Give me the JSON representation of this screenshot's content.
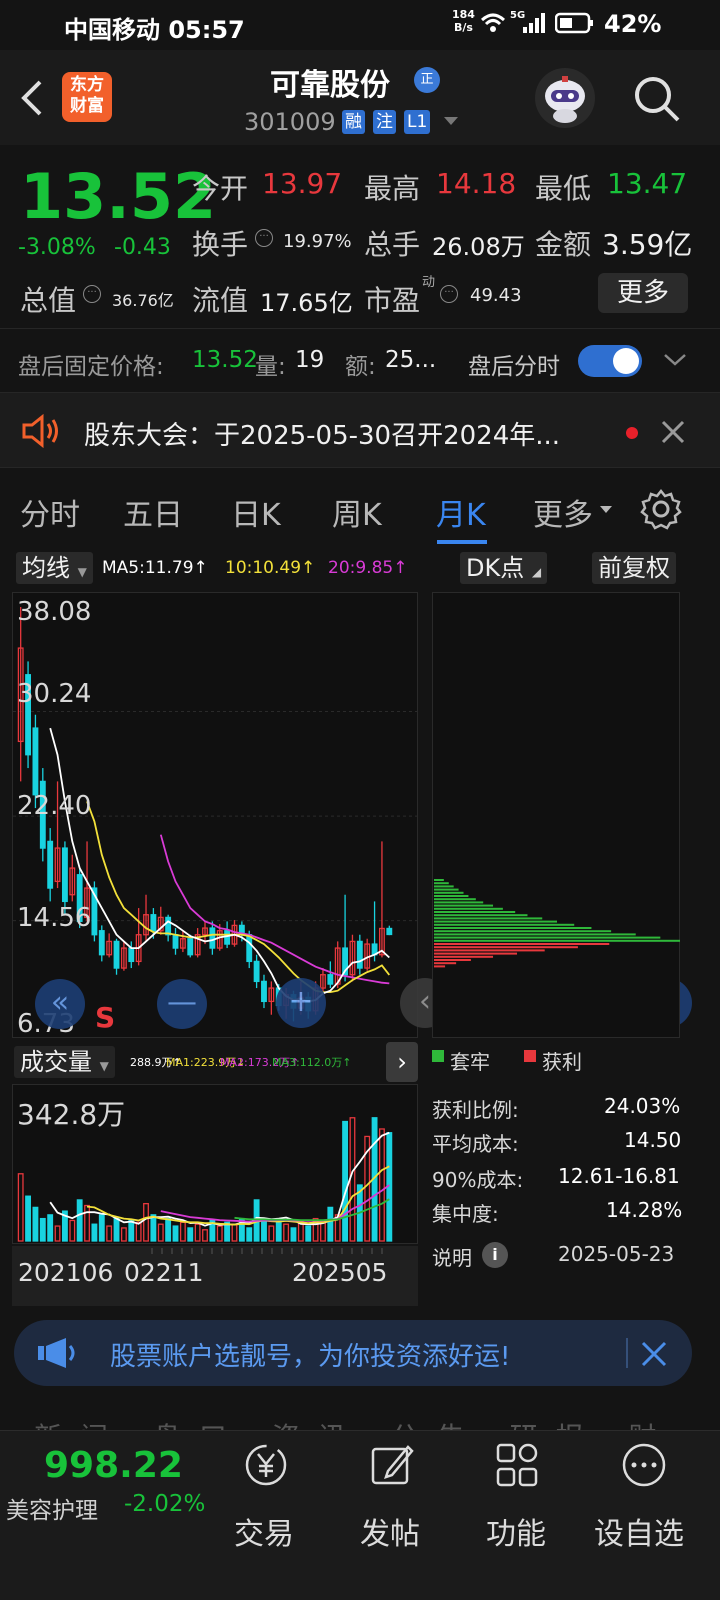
{
  "status_bar": {
    "carrier_time": "中国移动 05:57",
    "net_speed_value": "184",
    "net_speed_unit": "B/s",
    "signal": "5G",
    "battery": "42%"
  },
  "header": {
    "logo_line1": "东方",
    "logo_line2": "财富",
    "name": "可靠股份",
    "reg_badge": "正",
    "code": "301009",
    "tags": [
      "融",
      "注",
      "L1"
    ]
  },
  "quote": {
    "price": "13.52",
    "change_pct": "-3.08%",
    "change": "-0.43",
    "open_label": "今开",
    "open": "13.97",
    "high_label": "最高",
    "high": "14.18",
    "low_label": "最低",
    "low": "13.47",
    "turnover_label": "换手",
    "turnover": "19.97%",
    "volume_label": "总手",
    "volume": "26.08万",
    "amount_label": "金额",
    "amount": "3.59亿",
    "mktcap_label": "总值",
    "mktcap": "36.76亿",
    "float_label": "流值",
    "float": "17.65亿",
    "pe_label": "市盈",
    "pe_sup": "动",
    "pe": "49.43",
    "more": "更多"
  },
  "after_hours": {
    "price_label": "盘后固定价格:",
    "price": "13.52",
    "vol_label": "量:",
    "vol": "19",
    "amt_label": "额:",
    "amt": "25...",
    "toggle_label": "盘后分时",
    "toggle_on": true
  },
  "notice": {
    "text": "股东大会：于2025-05-30召开2024年..."
  },
  "tabs": [
    "分时",
    "五日",
    "日K",
    "周K",
    "月K",
    "更多"
  ],
  "active_tab": "月K",
  "chart_toolbar": {
    "ma_selector": "均线",
    "ma5": "MA5:11.79↑",
    "ma10": "10:10.49↑",
    "ma20": "20:9.85↑",
    "dk": "DK点",
    "adjust": "前复权"
  },
  "colors": {
    "up": "#e8383d",
    "down": "#19d3e0",
    "ma5": "#ffffff",
    "ma10": "#f2e03a",
    "ma20": "#d93bd6",
    "ma_vol3": "#2fb83a",
    "accent": "#3a86f0"
  },
  "chart_data": [
    {
      "type": "candlestick",
      "title": "月K",
      "y_ticks": [
        "38.08",
        "30.24",
        "22.40",
        "14.56",
        "6.73"
      ],
      "ylim": [
        6.73,
        38.08
      ],
      "x_ticks": [
        "202106",
        "02211",
        "202505"
      ],
      "marker": "S",
      "candles": [
        {
          "o": 28.0,
          "c": 35.0,
          "h": 38.08,
          "l": 25.0
        },
        {
          "o": 33.0,
          "c": 27.0,
          "h": 34.0,
          "l": 26.0
        },
        {
          "o": 29.0,
          "c": 24.0,
          "h": 30.0,
          "l": 23.0
        },
        {
          "o": 25.0,
          "c": 20.0,
          "h": 26.0,
          "l": 19.0
        },
        {
          "o": 20.5,
          "c": 17.0,
          "h": 21.5,
          "l": 16.0
        },
        {
          "o": 17.5,
          "c": 20.0,
          "h": 25.0,
          "l": 17.0
        },
        {
          "o": 20.0,
          "c": 16.0,
          "h": 20.5,
          "l": 15.0
        },
        {
          "o": 16.5,
          "c": 18.5,
          "h": 19.5,
          "l": 16.0
        },
        {
          "o": 18.0,
          "c": 14.5,
          "h": 18.5,
          "l": 14.0
        },
        {
          "o": 14.8,
          "c": 17.0,
          "h": 20.5,
          "l": 14.5
        },
        {
          "o": 17.0,
          "c": 13.5,
          "h": 17.5,
          "l": 13.0
        },
        {
          "o": 13.8,
          "c": 12.0,
          "h": 14.2,
          "l": 11.5
        },
        {
          "o": 12.0,
          "c": 13.0,
          "h": 13.6,
          "l": 11.8
        },
        {
          "o": 13.0,
          "c": 11.0,
          "h": 13.2,
          "l": 10.5
        },
        {
          "o": 11.0,
          "c": 12.5,
          "h": 13.0,
          "l": 10.8
        },
        {
          "o": 12.5,
          "c": 11.5,
          "h": 13.0,
          "l": 11.0
        },
        {
          "o": 11.5,
          "c": 13.5,
          "h": 15.5,
          "l": 11.2
        },
        {
          "o": 13.5,
          "c": 15.0,
          "h": 16.5,
          "l": 13.0
        },
        {
          "o": 15.0,
          "c": 13.8,
          "h": 15.5,
          "l": 13.2
        },
        {
          "o": 13.8,
          "c": 14.8,
          "h": 15.6,
          "l": 13.5
        },
        {
          "o": 14.8,
          "c": 13.5,
          "h": 15.0,
          "l": 13.0
        },
        {
          "o": 13.5,
          "c": 12.5,
          "h": 14.0,
          "l": 12.0
        },
        {
          "o": 12.5,
          "c": 13.2,
          "h": 13.8,
          "l": 12.2
        },
        {
          "o": 13.2,
          "c": 12.0,
          "h": 13.5,
          "l": 11.8
        },
        {
          "o": 12.0,
          "c": 13.5,
          "h": 14.0,
          "l": 11.8
        },
        {
          "o": 13.5,
          "c": 14.0,
          "h": 14.5,
          "l": 12.8
        },
        {
          "o": 14.0,
          "c": 12.5,
          "h": 14.5,
          "l": 12.0
        },
        {
          "o": 12.5,
          "c": 13.8,
          "h": 14.3,
          "l": 12.3
        },
        {
          "o": 13.8,
          "c": 12.8,
          "h": 14.5,
          "l": 12.5
        },
        {
          "o": 12.8,
          "c": 14.2,
          "h": 14.6,
          "l": 12.6
        },
        {
          "o": 14.2,
          "c": 13.5,
          "h": 14.5,
          "l": 13.0
        },
        {
          "o": 13.5,
          "c": 11.5,
          "h": 13.8,
          "l": 11.0
        },
        {
          "o": 11.5,
          "c": 10.0,
          "h": 12.0,
          "l": 9.5
        },
        {
          "o": 10.0,
          "c": 8.5,
          "h": 10.5,
          "l": 8.0
        },
        {
          "o": 8.5,
          "c": 9.5,
          "h": 10.0,
          "l": 7.5
        },
        {
          "o": 9.5,
          "c": 8.2,
          "h": 9.8,
          "l": 7.8
        },
        {
          "o": 8.2,
          "c": 9.0,
          "h": 9.5,
          "l": 7.2
        },
        {
          "o": 9.0,
          "c": 8.0,
          "h": 9.3,
          "l": 7.0
        },
        {
          "o": 8.0,
          "c": 8.8,
          "h": 10.0,
          "l": 7.5
        },
        {
          "o": 8.8,
          "c": 7.8,
          "h": 9.2,
          "l": 7.2
        },
        {
          "o": 7.8,
          "c": 9.5,
          "h": 10.0,
          "l": 7.5
        },
        {
          "o": 9.5,
          "c": 10.5,
          "h": 11.0,
          "l": 9.0
        },
        {
          "o": 10.5,
          "c": 9.8,
          "h": 11.5,
          "l": 9.5
        },
        {
          "o": 9.8,
          "c": 12.5,
          "h": 13.0,
          "l": 9.5
        },
        {
          "o": 12.5,
          "c": 10.5,
          "h": 16.5,
          "l": 10.0
        },
        {
          "o": 10.5,
          "c": 13.0,
          "h": 13.5,
          "l": 10.0
        },
        {
          "o": 13.0,
          "c": 11.0,
          "h": 13.5,
          "l": 10.5
        },
        {
          "o": 11.0,
          "c": 12.8,
          "h": 13.2,
          "l": 10.8
        },
        {
          "o": 12.8,
          "c": 12.0,
          "h": 16.0,
          "l": 11.5
        },
        {
          "o": 12.0,
          "c": 13.97,
          "h": 20.5,
          "l": 11.8
        },
        {
          "o": 13.97,
          "c": 13.52,
          "h": 14.18,
          "l": 13.47
        }
      ],
      "ma5": [
        null,
        null,
        null,
        null,
        29.0,
        27.0,
        23.5,
        20.5,
        18.5,
        17.5,
        16.5,
        15.5,
        14.5,
        13.5,
        13.0,
        12.5,
        12.5,
        13.0,
        13.5,
        14.0,
        14.5,
        14.2,
        13.8,
        13.4,
        13.2,
        13.0,
        13.1,
        13.3,
        13.4,
        13.5,
        13.3,
        12.9,
        12.3,
        11.5,
        10.6,
        9.5,
        8.9,
        8.6,
        8.7,
        8.5,
        8.6,
        9.1,
        9.3,
        9.9,
        10.8,
        11.4,
        11.5,
        11.8,
        12.0,
        12.3,
        11.79
      ],
      "ma10": [
        null,
        null,
        null,
        null,
        null,
        null,
        null,
        null,
        null,
        23.5,
        22.0,
        19.5,
        17.8,
        16.5,
        15.5,
        15.0,
        14.5,
        14.0,
        13.7,
        13.6,
        13.6,
        13.5,
        13.4,
        13.3,
        13.3,
        13.4,
        13.5,
        13.5,
        13.5,
        13.5,
        13.5,
        13.4,
        13.1,
        12.8,
        12.3,
        11.8,
        11.2,
        10.6,
        10.1,
        9.7,
        9.3,
        9.2,
        9.2,
        9.3,
        9.7,
        10.1,
        10.4,
        10.7,
        10.9,
        11.2,
        10.49
      ],
      "ma20": [
        null,
        null,
        null,
        null,
        null,
        null,
        null,
        null,
        null,
        null,
        null,
        null,
        null,
        null,
        null,
        null,
        null,
        null,
        null,
        21.0,
        19.0,
        17.5,
        16.5,
        15.5,
        15.0,
        14.5,
        14.3,
        14.0,
        13.9,
        13.7,
        13.6,
        13.5,
        13.3,
        13.1,
        12.9,
        12.6,
        12.3,
        12.0,
        11.7,
        11.4,
        11.1,
        10.9,
        10.7,
        10.5,
        10.4,
        10.3,
        10.2,
        10.1,
        10.0,
        9.9,
        9.85
      ]
    },
    {
      "type": "bar",
      "title": "成交量",
      "ylabel_top": "342.8万",
      "ymax": 342.8,
      "legend": {
        "ma0": "288.9万↑",
        "ma1": "MA1:223.9万↓",
        "ma2": "MA2:173.2万↑",
        "ma3": "MA3:112.0万↑"
      },
      "values": [
        180,
        120,
        90,
        60,
        70,
        40,
        80,
        55,
        110,
        95,
        45,
        70,
        40,
        60,
        35,
        55,
        50,
        100,
        70,
        45,
        60,
        40,
        50,
        35,
        45,
        30,
        55,
        40,
        50,
        45,
        60,
        35,
        110,
        60,
        40,
        55,
        45,
        35,
        50,
        40,
        60,
        50,
        90,
        70,
        320,
        330,
        150,
        280,
        330,
        300,
        290
      ],
      "ma_lines": {
        "white": [
          null,
          null,
          null,
          null,
          104,
          76,
          68,
          61,
          71,
          77,
          77,
          73,
          71,
          60,
          50,
          52,
          46,
          60,
          64,
          64,
          65,
          60,
          56,
          48,
          49,
          41,
          48,
          43,
          45,
          44,
          49,
          47,
          62,
          61,
          58,
          60,
          63,
          56,
          46,
          45,
          45,
          48,
          55,
          64,
          128,
          186,
          212,
          240,
          262,
          282,
          290
        ],
        "yellow": [
          null,
          null,
          null,
          null,
          null,
          null,
          null,
          null,
          null,
          92,
          90,
          80,
          70,
          65,
          60,
          58,
          55,
          62,
          65,
          60,
          58,
          55,
          52,
          50,
          50,
          48,
          48,
          46,
          45,
          44,
          46,
          45,
          52,
          55,
          53,
          52,
          54,
          52,
          50,
          48,
          50,
          50,
          54,
          57,
          87,
          120,
          132,
          150,
          170,
          190,
          200
        ],
        "magenta": [
          null,
          null,
          null,
          null,
          null,
          null,
          null,
          null,
          null,
          null,
          null,
          null,
          null,
          null,
          null,
          null,
          null,
          null,
          null,
          80,
          76,
          72,
          68,
          64,
          62,
          60,
          58,
          56,
          55,
          54,
          53,
          52,
          54,
          55,
          55,
          56,
          56,
          55,
          55,
          54,
          55,
          55,
          57,
          59,
          72,
          86,
          95,
          108,
          122,
          135,
          150
        ],
        "green": [
          null,
          null,
          null,
          null,
          null,
          null,
          null,
          null,
          null,
          null,
          null,
          null,
          null,
          null,
          null,
          null,
          null,
          null,
          null,
          null,
          null,
          null,
          null,
          null,
          null,
          null,
          null,
          null,
          null,
          62,
          60,
          58,
          58,
          58,
          57,
          57,
          57,
          57,
          56,
          56,
          56,
          56,
          57,
          58,
          64,
          70,
          76,
          84,
          92,
          100,
          112
        ]
      }
    },
    {
      "type": "bar",
      "title": "DK点",
      "orientation": "horizontal",
      "series": [
        {
          "name": "套牢",
          "color": "#2fb83a"
        },
        {
          "name": "获利",
          "color": "#e8383d"
        }
      ],
      "profit_rows": [
        0.95,
        0.78,
        0.6,
        0.45,
        0.32,
        0.2,
        0.12,
        0.06
      ],
      "trapped_rows": [
        0.04,
        0.06,
        0.08,
        0.1,
        0.12,
        0.14,
        0.17,
        0.2,
        0.24,
        0.28,
        0.33,
        0.38,
        0.44,
        0.5,
        0.57,
        0.64,
        0.72,
        0.82,
        0.92,
        1.0
      ],
      "stats": [
        {
          "label": "获利比例:",
          "value": "24.03%"
        },
        {
          "label": "平均成本:",
          "value": "14.50"
        },
        {
          "label": "90%成本:",
          "value": "12.61-16.81"
        },
        {
          "label": "集中度:",
          "value": "14.28%"
        }
      ],
      "note_label": "说明",
      "date": "2025-05-23"
    }
  ],
  "banner": {
    "text": "股票账户选靓号，为你投资添好运!"
  },
  "bottom_bar": {
    "index_value": "998.22",
    "index_name": "美容护理",
    "index_change": "-2.02%",
    "items": [
      "交易",
      "发帖",
      "功能",
      "设自选"
    ],
    "hidden_tabs": "新闻  盘口  资讯  公告  研报  财务  资料"
  }
}
